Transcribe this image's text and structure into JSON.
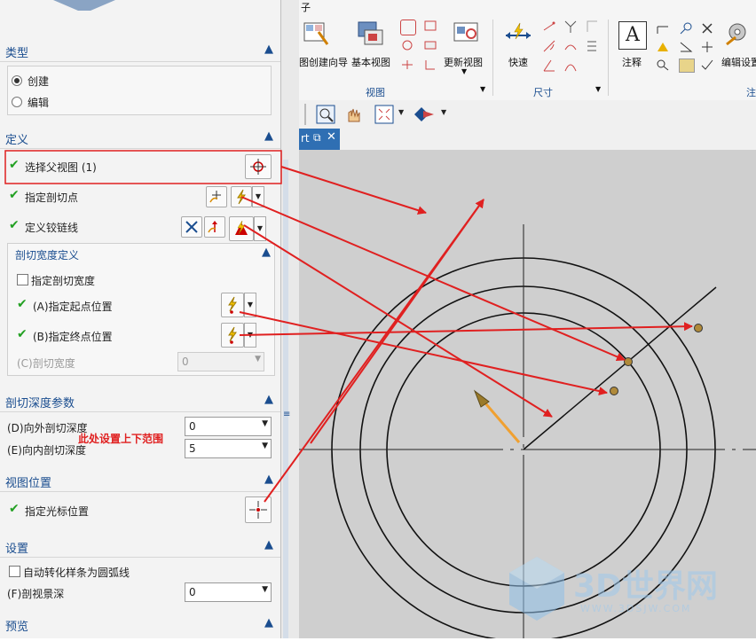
{
  "panel": {
    "type_section": {
      "title": "类型",
      "options": [
        "创建",
        "编辑"
      ],
      "selected": "创建"
    },
    "define_section": {
      "title": "定义",
      "select_parent_view": "选择父视图 (1)",
      "specify_cut_point": "指定剖切点",
      "define_hinge_line": "定义铰链线",
      "width_group": {
        "title": "剖切宽度定义",
        "specify_width": "指定剖切宽度",
        "start_point": "(A)指定起点位置",
        "end_point": "(B)指定终点位置",
        "cut_width": "(C)剖切宽度",
        "cut_width_value": "0"
      }
    },
    "depth_section": {
      "title": "剖切深度参数",
      "outward": "(D)向外剖切深度",
      "outward_value": "0",
      "inward": "(E)向内剖切深度",
      "inward_value": "5",
      "annotation": "此处设置上下范围"
    },
    "view_pos_section": {
      "title": "视图位置",
      "cursor_pos": "指定光标位置"
    },
    "settings_section": {
      "title": "设置",
      "auto_convert": "自动转化样条为圆弧线",
      "section_depth": "(F)剖视景深",
      "section_depth_value": "0"
    },
    "preview_section": {
      "title": "预览"
    }
  },
  "ribbon": {
    "partial_top_left": "子",
    "view_group": {
      "label": "视图",
      "wizard": "图创建向导",
      "base_view": "基本视图",
      "update_view": "更新视图"
    },
    "dim_group": {
      "label": "尺寸",
      "quick": "快速"
    },
    "note_group": {
      "label": "注",
      "note": "注释",
      "edit_settings": "编辑设置"
    }
  },
  "tab": {
    "label": "rt"
  },
  "watermark": {
    "title": "3D世界网",
    "url": "WWW.3DSJW.COM"
  },
  "colors": {
    "annotation_red": "#e02020",
    "panel_header": "#1a4d8f",
    "canvas_bg": "#cfcfcf",
    "check_green": "#22a022"
  }
}
